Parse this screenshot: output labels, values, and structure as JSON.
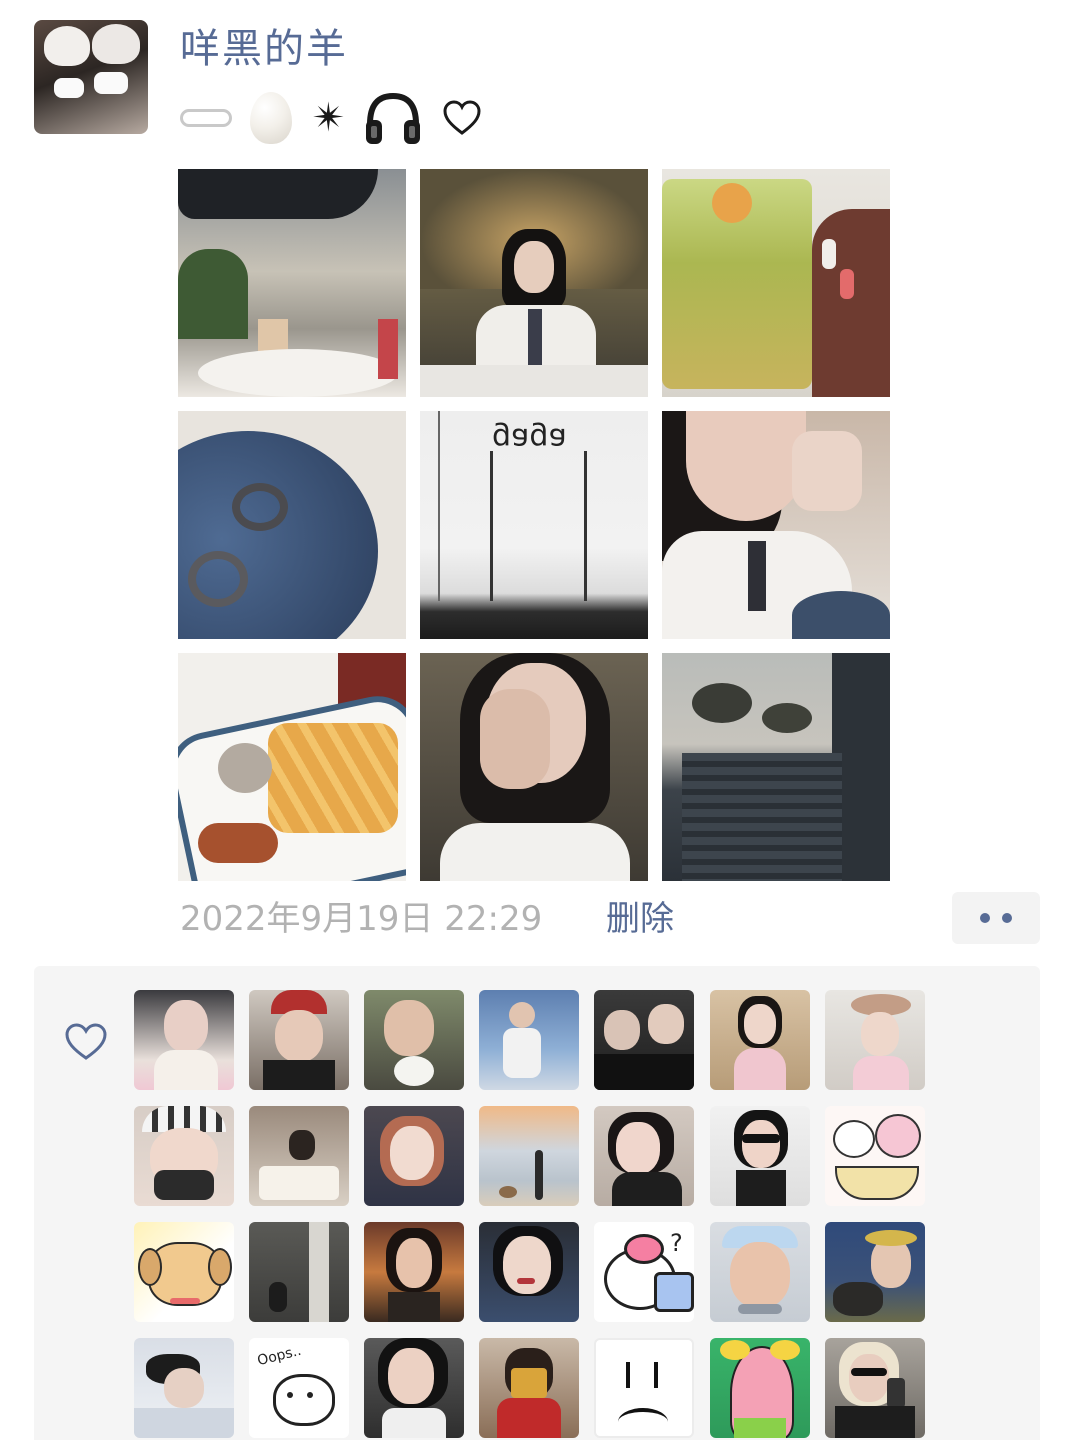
{
  "post": {
    "author": {
      "nickname": "咩黑的羊"
    },
    "signature_icons": [
      "paperclip-icon",
      "egg-icon",
      "sparkle-icon",
      "headphones-icon",
      "heart-outline-icon"
    ],
    "signature_text": {
      "sparkle": "✴"
    },
    "photos": [
      {
        "icon": "cafe-terrace-photo"
      },
      {
        "icon": "girl-in-cafe-photo"
      },
      {
        "icon": "iced-drink-photo"
      },
      {
        "icon": "rings-on-plate-photo"
      },
      {
        "icon": "store-sign-photo",
        "sign_text": "gaga"
      },
      {
        "icon": "selfie-nails-photo"
      },
      {
        "icon": "fries-plate-photo"
      },
      {
        "icon": "hand-selfie-photo"
      },
      {
        "icon": "outdoor-stairs-photo"
      }
    ],
    "timestamp": "2022年9月19日 22:29",
    "delete_label": "删除",
    "more_icon": "more-dots-icon"
  },
  "likes": {
    "icon": "heart-outline-icon",
    "avatars": [
      "liker-avatar-1",
      "liker-avatar-2",
      "liker-avatar-3",
      "liker-avatar-4",
      "liker-avatar-5",
      "liker-avatar-6",
      "liker-avatar-7",
      "liker-avatar-8",
      "liker-avatar-9",
      "liker-avatar-10",
      "liker-avatar-11",
      "liker-avatar-12",
      "liker-avatar-13",
      "liker-avatar-14",
      "liker-avatar-15",
      "liker-avatar-16",
      "liker-avatar-17",
      "liker-avatar-18",
      "liker-avatar-19",
      "liker-avatar-20",
      "liker-avatar-21",
      "liker-avatar-22",
      "liker-avatar-23",
      "liker-avatar-24",
      "liker-avatar-25",
      "liker-avatar-26",
      "liker-avatar-27",
      "liker-avatar-28"
    ],
    "sticker_texts": {
      "oops": "Oops..",
      "question": "?"
    }
  },
  "colors": {
    "link_blue": "#576b95",
    "time_grey": "#b2b2b2",
    "panel_bg": "#f5f5f5"
  }
}
